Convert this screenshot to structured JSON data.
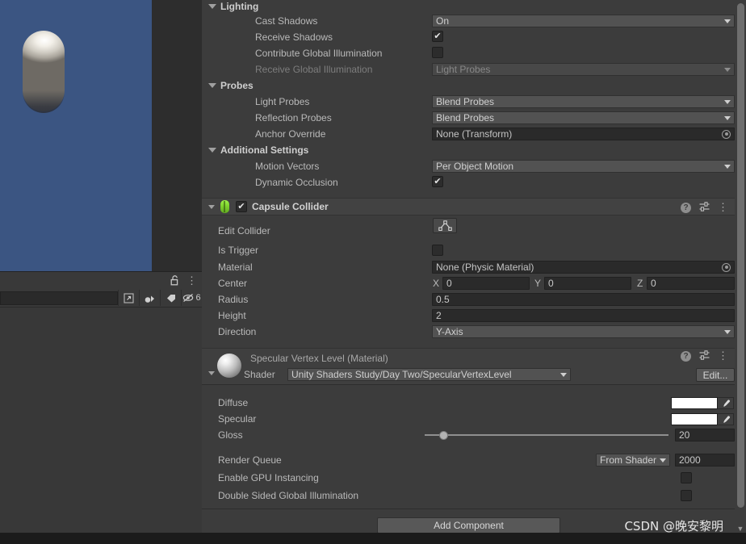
{
  "scene": {
    "object_name": "capsule-preview",
    "background_color": "#3b5582"
  },
  "left_panel": {
    "search_placeholder": "",
    "search_value": "",
    "icons": [
      "lock-icon",
      "kebab-menu-icon",
      "popout-icon",
      "lighting-icon",
      "tag-icon",
      "hidden-objects-icon"
    ],
    "hidden_count": "6"
  },
  "inspector": {
    "renderer_sections": [
      {
        "name": "Lighting",
        "rows": [
          {
            "label": "Cast Shadows",
            "type": "dropdown",
            "value": "On",
            "disabled": false
          },
          {
            "label": "Receive Shadows",
            "type": "checkbox",
            "checked": true
          },
          {
            "label": "Contribute Global Illumination",
            "type": "checkbox",
            "checked": false
          },
          {
            "label": "Receive Global Illumination",
            "type": "dropdown",
            "value": "Light Probes",
            "disabled": true
          }
        ]
      },
      {
        "name": "Probes",
        "rows": [
          {
            "label": "Light Probes",
            "type": "dropdown",
            "value": "Blend Probes",
            "disabled": false
          },
          {
            "label": "Reflection Probes",
            "type": "dropdown",
            "value": "Blend Probes",
            "disabled": false
          },
          {
            "label": "Anchor Override",
            "type": "objectfield",
            "value": "None (Transform)"
          }
        ]
      },
      {
        "name": "Additional Settings",
        "rows": [
          {
            "label": "Motion Vectors",
            "type": "dropdown",
            "value": "Per Object Motion",
            "disabled": false
          },
          {
            "label": "Dynamic Occlusion",
            "type": "checkbox",
            "checked": true
          }
        ]
      }
    ],
    "collider": {
      "title": "Capsule Collider",
      "enabled": true,
      "rows": {
        "edit_collider_label": "Edit Collider",
        "is_trigger_label": "Is Trigger",
        "is_trigger_checked": false,
        "material_label": "Material",
        "material_value": "None (Physic Material)",
        "center_label": "Center",
        "center_x_axis": "X",
        "center_x": "0",
        "center_y_axis": "Y",
        "center_y": "0",
        "center_z_axis": "Z",
        "center_z": "0",
        "radius_label": "Radius",
        "radius_value": "0.5",
        "height_label": "Height",
        "height_value": "2",
        "direction_label": "Direction",
        "direction_value": "Y-Axis"
      }
    },
    "material": {
      "title": "Specular Vertex Level (Material)",
      "shader_label": "Shader",
      "shader_value": "Unity Shaders Study/Day Two/SpecularVertexLevel",
      "edit_button": "Edit...",
      "properties": [
        {
          "label": "Diffuse",
          "type": "color",
          "value": "#ffffff"
        },
        {
          "label": "Specular",
          "type": "color",
          "value": "#ffffff"
        },
        {
          "label": "Gloss",
          "type": "slider",
          "value": "20",
          "min": 8,
          "max": 256,
          "knob_pct": 6
        }
      ],
      "render_queue_label": "Render Queue",
      "render_queue_mode": "From Shader",
      "render_queue_value": "2000",
      "gpu_instancing_label": "Enable GPU Instancing",
      "gpu_instancing_checked": false,
      "double_sided_gi_label": "Double Sided Global Illumination",
      "double_sided_gi_checked": false
    },
    "add_component_label": "Add Component",
    "help_icon": "help-icon",
    "preset_icon": "preset-icon",
    "menu_icon": "kebab-menu-icon"
  },
  "watermark": {
    "text": "CSDN @晚安黎明"
  },
  "colors": {
    "panel_bg": "#3c3c3c",
    "header_bg": "#424242",
    "field_bg": "#2a2a2a",
    "dropdown_bg": "#525252",
    "scene_bg": "#3b5582",
    "collider_green": "#7fd32e"
  }
}
